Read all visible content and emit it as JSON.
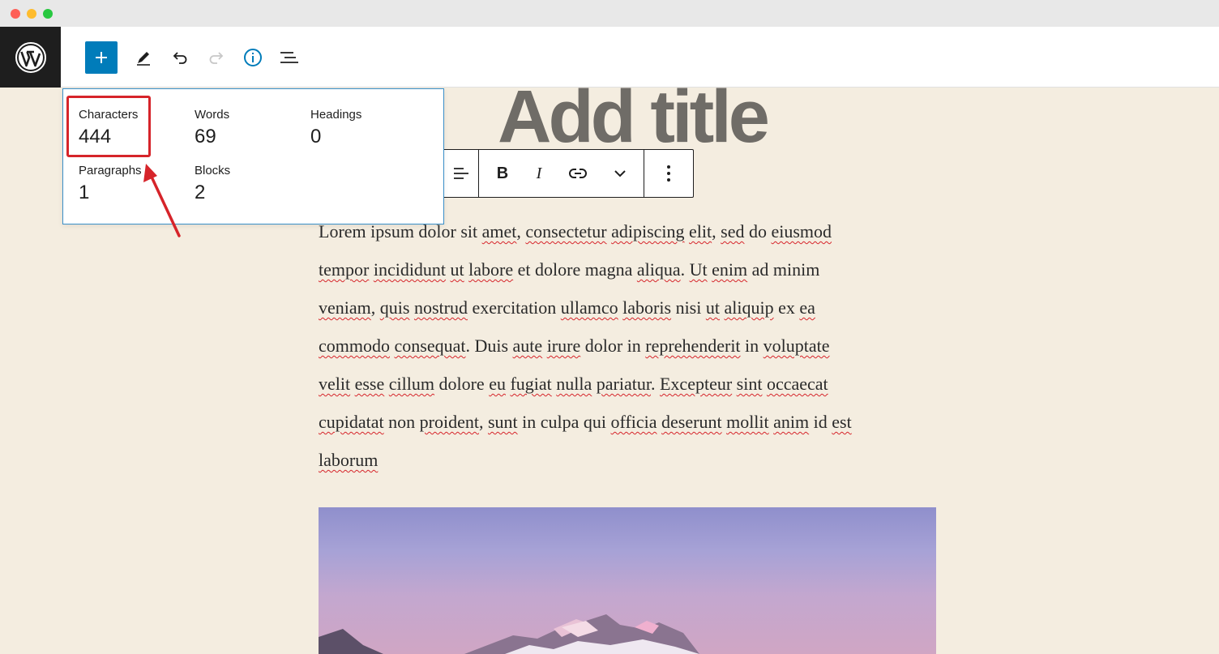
{
  "window": {
    "controls": [
      "close",
      "minimize",
      "maximize"
    ]
  },
  "toolbar": {
    "logo_icon": "wordpress-logo-icon",
    "buttons": [
      {
        "name": "add-block",
        "icon": "plus-icon"
      },
      {
        "name": "edit-tools",
        "icon": "pencil-icon"
      },
      {
        "name": "undo",
        "icon": "undo-icon"
      },
      {
        "name": "redo",
        "icon": "redo-icon",
        "disabled": true
      },
      {
        "name": "details",
        "icon": "info-icon",
        "active": true
      },
      {
        "name": "list-view",
        "icon": "list-view-icon"
      }
    ]
  },
  "info_panel": {
    "characters": {
      "label": "Characters",
      "value": "444"
    },
    "words": {
      "label": "Words",
      "value": "69"
    },
    "headings": {
      "label": "Headings",
      "value": "0"
    },
    "paragraphs": {
      "label": "Paragraphs",
      "value": "1"
    },
    "blocks": {
      "label": "Blocks",
      "value": "2"
    }
  },
  "post": {
    "title_placeholder": "Add title",
    "paragraph_lines": [
      "Lorem ipsum dolor sit amet, consectetur adipiscing elit, sed do eiusmod",
      "tempor incididunt ut labore et dolore magna aliqua. Ut enim ad minim",
      "veniam, quis nostrud exercitation ullamco laboris nisi ut aliquip ex ea",
      "commodo consequat. Duis aute irure dolor in reprehenderit in voluptate",
      "velit esse cillum dolore eu fugiat nulla pariatur. Excepteur sint occaecat",
      "cupidatat non proident, sunt in culpa qui officia deserunt mollit anim id est",
      "laborum"
    ]
  },
  "block_toolbar": {
    "bold_label": "B",
    "italic_label": "I",
    "icons": [
      "align-icon",
      "link-icon",
      "chevron-down-icon",
      "more-options-icon"
    ]
  },
  "colors": {
    "accent": "#007cba",
    "highlight": "#d6242a",
    "canvas": "#f4ede0"
  }
}
